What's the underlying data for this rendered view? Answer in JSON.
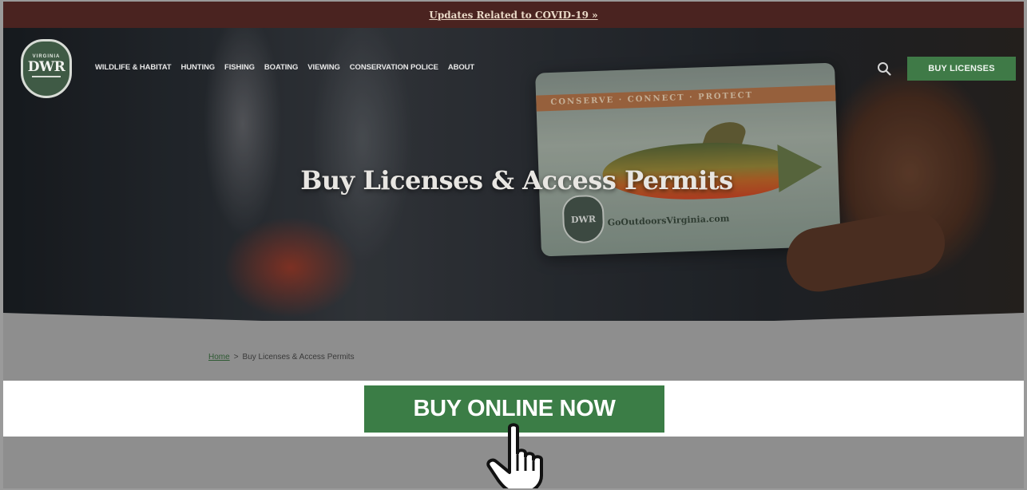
{
  "alert_bar": {
    "link_text": "Updates Related to COVID-19 »"
  },
  "logo": {
    "top_text": "VIRGINIA",
    "main_text": "DWR"
  },
  "nav": {
    "items": [
      "WILDLIFE & HABITAT",
      "HUNTING",
      "FISHING",
      "BOATING",
      "VIEWING",
      "CONSERVATION POLICE",
      "ABOUT"
    ]
  },
  "header": {
    "search_icon": "search-icon",
    "buy_licenses_label": "BUY LICENSES"
  },
  "hero": {
    "title": "Buy Licenses & Access Permits",
    "card_stripe_text": "CONSERVE · CONNECT · PROTECT",
    "card_logo_text": "DWR",
    "card_url_text": "GoOutdoorsVirginia.com"
  },
  "breadcrumb": {
    "home": "Home",
    "separator": ">",
    "current": "Buy Licenses & Access Permits"
  },
  "cta": {
    "label": "BUY ONLINE NOW"
  },
  "colors": {
    "alert_bar": "#4a2320",
    "brand_green": "#3f7a47",
    "cta_green": "#3b7d46"
  }
}
